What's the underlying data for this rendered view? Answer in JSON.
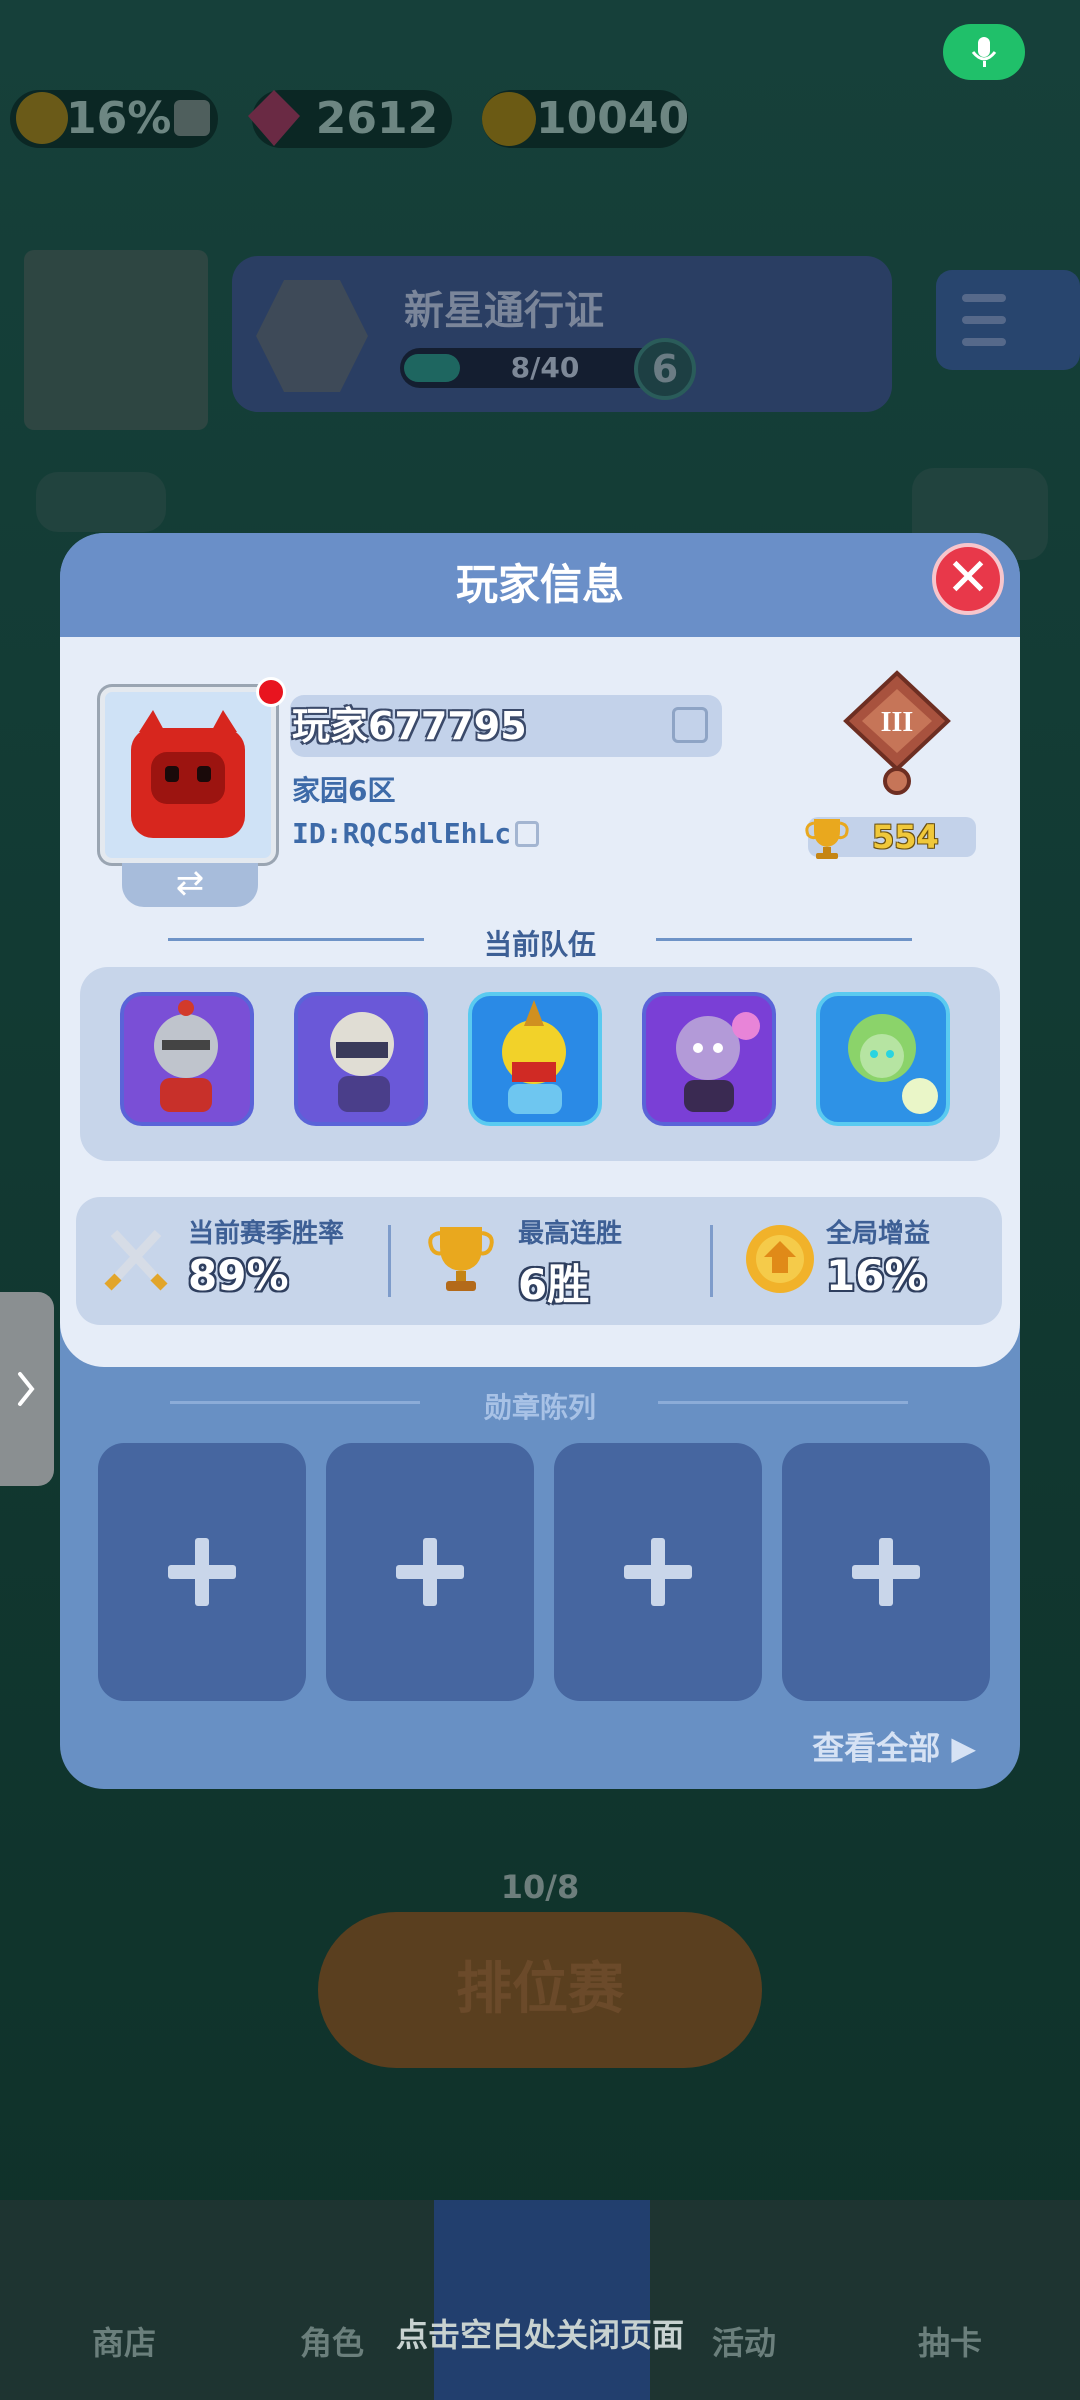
{
  "top_bar": {
    "buff_percent": "16%",
    "gems": "2612",
    "coins": "10040"
  },
  "pass": {
    "title": "新星通行证",
    "progress": "8/40",
    "level": "6",
    "progress_fraction": 0.2
  },
  "dialog": {
    "title": "玩家信息",
    "player": {
      "name": "玩家677795",
      "home": "家园6区",
      "id": "ID:RQC5dlEhLc",
      "rank_numeral": "III",
      "trophies": "554"
    },
    "team_label": "当前队伍",
    "team": [
      {
        "icon": "knight-hero-icon"
      },
      {
        "icon": "ninja-hero-icon"
      },
      {
        "icon": "king-hero-icon"
      },
      {
        "icon": "shadow-hero-icon"
      },
      {
        "icon": "forest-fairy-hero-icon"
      }
    ],
    "stats": [
      {
        "label": "当前赛季胜率",
        "value": "89%",
        "icon": "crossed-swords-icon"
      },
      {
        "label": "最高连胜",
        "value": "6胜",
        "icon": "trophy-icon"
      },
      {
        "label": "全局增益",
        "value": "16%",
        "icon": "buff-badge-icon"
      }
    ],
    "medal_label": "勋章陈列",
    "medal_slots": 4,
    "view_all": "查看全部"
  },
  "bottom": {
    "tickets": "10/8",
    "rank_match": "排位赛",
    "hint": "点击空白处关闭页面",
    "nav": [
      "商店",
      "角色",
      "活动",
      "抽卡"
    ]
  },
  "colors": {
    "dialog_bg": "#6890c4",
    "panel_bg": "#e6edf8",
    "close_red": "#e8384a",
    "mic_green": "#20c06a"
  }
}
